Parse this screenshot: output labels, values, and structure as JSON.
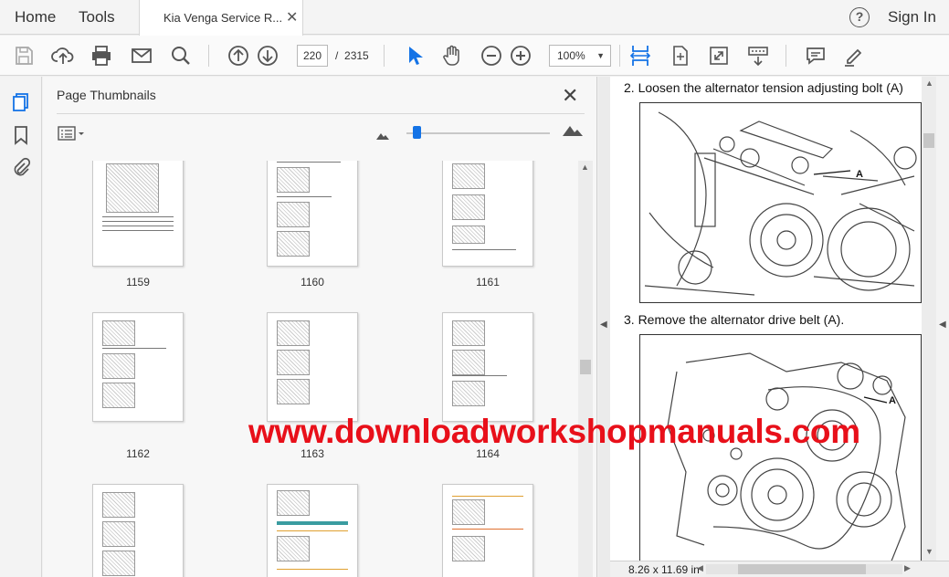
{
  "menubar": {
    "home_label": "Home",
    "tools_label": "Tools",
    "document_tab_title": "Kia Venga Service R...",
    "close_glyph": "✕",
    "help_glyph": "?",
    "signin_label": "Sign In"
  },
  "toolbar": {
    "icons": [
      "save-icon",
      "upload-icon",
      "print-icon",
      "email-icon",
      "search-icon",
      "prev-page-icon",
      "next-page-icon",
      "select-cursor-icon",
      "hand-icon",
      "zoom-out-icon",
      "zoom-in-icon",
      "fit-width-icon",
      "rotate-icon",
      "fullscreen-icon",
      "scroll-mode-icon",
      "comment-icon",
      "highlight-pen-icon"
    ],
    "current_page": "220",
    "page_separator": "/",
    "total_pages": "2315",
    "zoom": "100%",
    "accent_color": "#1473e6"
  },
  "panel": {
    "title": "Page Thumbnails",
    "close_glyph": "✕",
    "thumbnails": [
      {
        "label": "1159"
      },
      {
        "label": "1160"
      },
      {
        "label": "1161"
      },
      {
        "label": "1162"
      },
      {
        "label": "1163"
      },
      {
        "label": "1164"
      },
      {
        "label": ""
      },
      {
        "label": ""
      },
      {
        "label": ""
      }
    ]
  },
  "document": {
    "step2": "2. Loosen the alternator tension adjusting bolt (A)",
    "step3": "3. Remove the alternator drive belt (A).",
    "callout_a": "A",
    "page_size": "8.26 x 11.69 in"
  },
  "watermark": {
    "text": "www.downloadworkshopmanuals.com",
    "color": "#e8101a"
  }
}
